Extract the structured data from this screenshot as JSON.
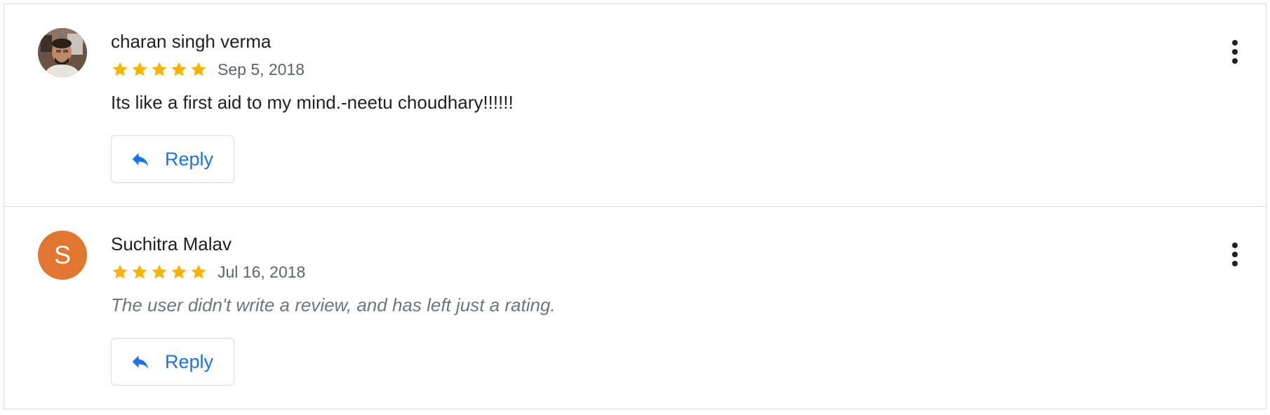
{
  "colors": {
    "star": "#f4b400",
    "accent": "#1a73e8",
    "avatar_s": "#e0762f",
    "border": "#dadce0"
  },
  "reviews": [
    {
      "author": "charan singh verma",
      "avatar_type": "photo",
      "rating": 5,
      "date": "Sep 5, 2018",
      "text": "Its like a first aid to my mind.-neetu choudhary!!!!!!",
      "reply_label": "Reply",
      "more_icon": "more-vert-icon",
      "reply_icon": "reply-arrow-icon"
    },
    {
      "author": "Suchitra Malav",
      "avatar_type": "letter",
      "avatar_letter": "S",
      "rating": 5,
      "date": "Jul 16, 2018",
      "text": "The user didn't write a review, and has left just a rating.",
      "reply_label": "Reply",
      "more_icon": "more-vert-icon",
      "reply_icon": "reply-arrow-icon"
    }
  ]
}
